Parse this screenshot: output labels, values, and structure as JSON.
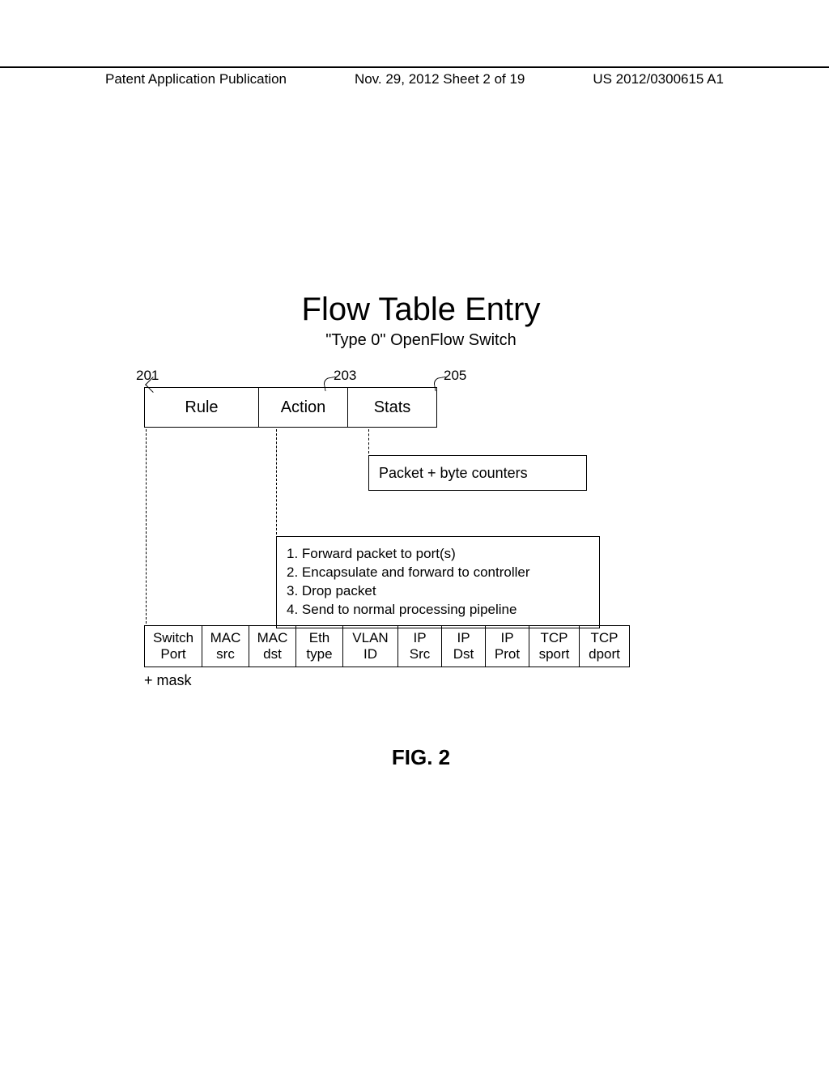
{
  "header": {
    "left": "Patent Application Publication",
    "mid": "Nov. 29, 2012  Sheet 2 of 19",
    "right": "US 2012/0300615 A1"
  },
  "title": "Flow Table Entry",
  "subtitle": "\"Type 0\" OpenFlow Switch",
  "refs": {
    "r201": "201",
    "r203": "203",
    "r205": "205"
  },
  "toprow": {
    "rule": "Rule",
    "action": "Action",
    "stats": "Stats"
  },
  "stats_detail": "Packet + byte counters",
  "action_detail": [
    "1. Forward packet to port(s)",
    "2. Encapsulate and forward to controller",
    "3. Drop packet",
    "4. Send to normal processing pipeline"
  ],
  "fields": [
    {
      "l1": "Switch",
      "l2": "Port"
    },
    {
      "l1": "MAC",
      "l2": "src"
    },
    {
      "l1": "MAC",
      "l2": "dst"
    },
    {
      "l1": "Eth",
      "l2": "type"
    },
    {
      "l1": "VLAN",
      "l2": "ID"
    },
    {
      "l1": "IP",
      "l2": "Src"
    },
    {
      "l1": "IP",
      "l2": "Dst"
    },
    {
      "l1": "IP",
      "l2": "Prot"
    },
    {
      "l1": "TCP",
      "l2": "sport"
    },
    {
      "l1": "TCP",
      "l2": "dport"
    }
  ],
  "mask": "+ mask",
  "figure_label": "FIG. 2"
}
